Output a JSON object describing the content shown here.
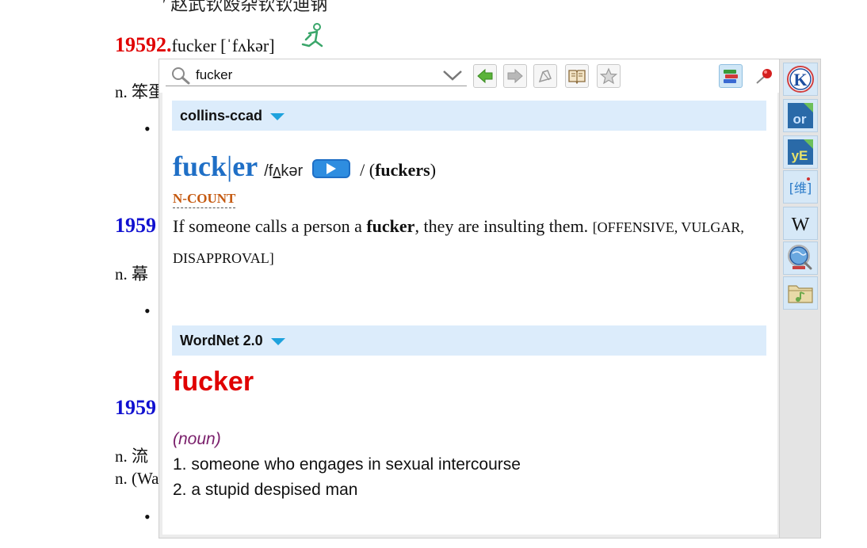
{
  "background": {
    "entry1": {
      "number": "19592.",
      "word": "fucker [ˈfʌkər]"
    },
    "entry1_meaning": "n. 笨蛋",
    "entry2": {
      "number": "1959"
    },
    "entry2_meaning": "n. 幕",
    "entry3": {
      "number": "1959"
    },
    "entry3_meaning": "n. 流",
    "entry3_meaning2": "n. (Wa",
    "bullet": "•",
    "top_cut_text": "ʹ 赵武钦殴杂钦钦迪钠"
  },
  "search": {
    "value": "fucker"
  },
  "toolbar": {
    "buttons": [
      "back-button",
      "forward-button",
      "speak-button",
      "open-dictionary-button",
      "favorite-button",
      "dictionaries-button"
    ]
  },
  "collins": {
    "name": "collins-ccad",
    "headword_part1": "fuck",
    "headword_sep": "|",
    "headword_part2": "er",
    "pron_a": "/f",
    "pron_u": "ʌ",
    "pron_b": "kər",
    "inflection_open": "/ (",
    "inflection_word": "fuckers",
    "inflection_close": ")",
    "grammar": "N-COUNT",
    "def_a": "If someone calls a person a ",
    "def_bold": "fucker",
    "def_b": ", they are insulting them. ",
    "def_label": "[OFFENSIVE, VULGAR, DISAPPROVAL]"
  },
  "wordnet": {
    "name": "WordNet 2.0",
    "word": "fucker",
    "pos": "(noun)",
    "senses": [
      "1. someone who engages in sexual intercourse",
      "2. a stupid despised man"
    ]
  },
  "sidebar": {
    "items": [
      "K",
      "or",
      "yE",
      "[维]",
      "W"
    ]
  },
  "colors": {
    "accent_blue": "#1f6fc6",
    "header_bg": "#dcecfb",
    "red": "#e00000",
    "pos_purple": "#7a1f6b",
    "grammar_orange": "#c55a11"
  }
}
